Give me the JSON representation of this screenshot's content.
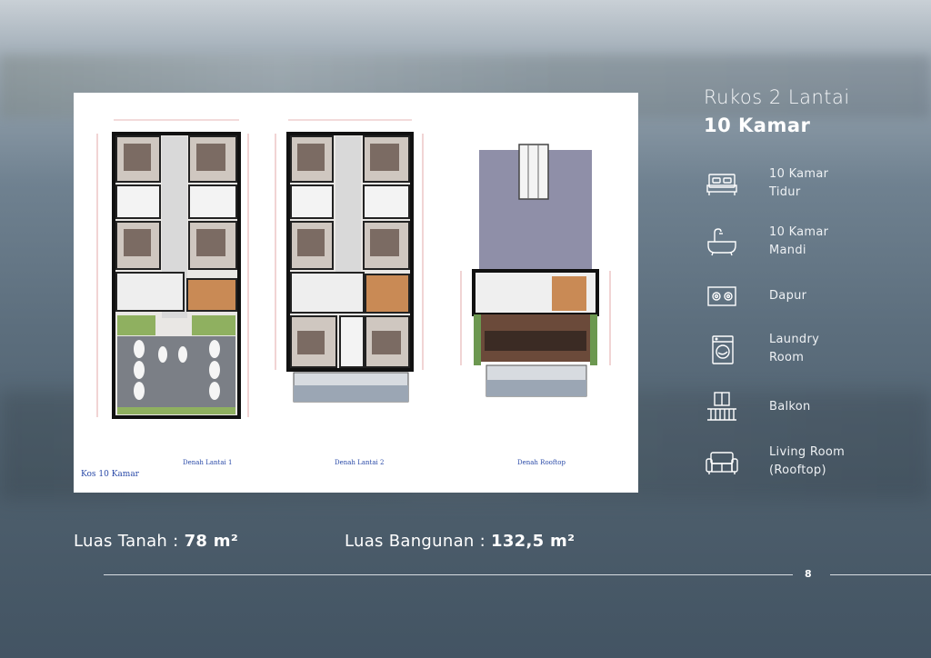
{
  "header": {
    "title_line1": "Rukos 2 Lantai",
    "title_line2": "10 Kamar"
  },
  "plan": {
    "labels": [
      "Denah Lantai 1",
      "Denah Lantai 2",
      "Denah Rooftop"
    ],
    "note": "Kos 10 Kamar"
  },
  "features": [
    {
      "icon": "bed-icon",
      "label": "10 Kamar\nTidur"
    },
    {
      "icon": "bathtub-icon",
      "label": "10 Kamar\nMandi"
    },
    {
      "icon": "stove-icon",
      "label": "Dapur"
    },
    {
      "icon": "washing-machine-icon",
      "label": "Laundry\nRoom"
    },
    {
      "icon": "balcony-icon",
      "label": "Balkon"
    },
    {
      "icon": "sofa-icon",
      "label": "Living Room\n(Rooftop)"
    }
  ],
  "areas": {
    "land_label": "Luas Tanah : ",
    "land_value": "78 m²",
    "building_label": "Luas Bangunan : ",
    "building_value": "132,5 m²"
  },
  "footer": {
    "page_number": "8"
  },
  "colors": {
    "accent_white": "#ffffff",
    "label_blue": "#2a4aa8"
  }
}
